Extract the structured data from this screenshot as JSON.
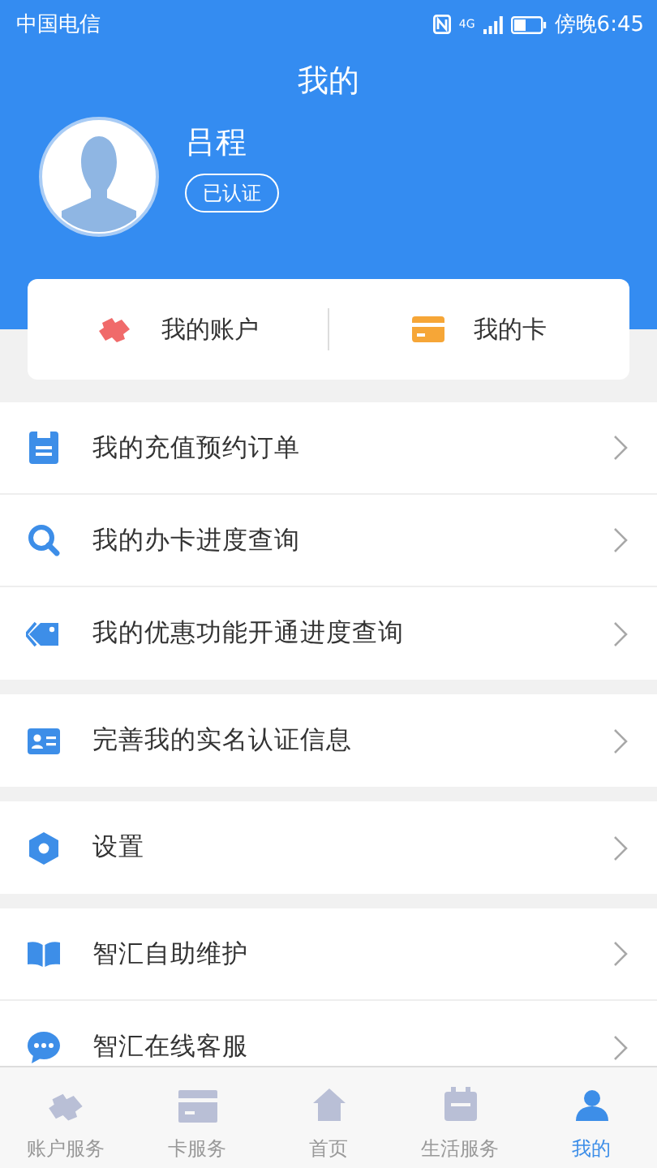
{
  "status_bar": {
    "carrier": "中国电信",
    "network": "4G",
    "time": "傍晚6:45"
  },
  "header": {
    "title": "我的"
  },
  "profile": {
    "name": "吕程",
    "badge": "已认证"
  },
  "quick_links": [
    {
      "label": "我的账户"
    },
    {
      "label": "我的卡"
    }
  ],
  "menu_groups": [
    {
      "items": [
        {
          "label": "我的充值预约订单"
        },
        {
          "label": "我的办卡进度查询"
        },
        {
          "label": "我的优惠功能开通进度查询"
        }
      ]
    },
    {
      "items": [
        {
          "label": "完善我的实名认证信息"
        }
      ]
    },
    {
      "items": [
        {
          "label": "设置"
        }
      ]
    },
    {
      "items": [
        {
          "label": "智汇自助维护"
        },
        {
          "label": "智汇在线客服"
        }
      ]
    }
  ],
  "tab_bar": [
    {
      "label": "账户服务",
      "selected": false
    },
    {
      "label": "卡服务",
      "selected": false
    },
    {
      "label": "首页",
      "selected": false
    },
    {
      "label": "生活服务",
      "selected": false
    },
    {
      "label": "我的",
      "selected": true
    }
  ]
}
